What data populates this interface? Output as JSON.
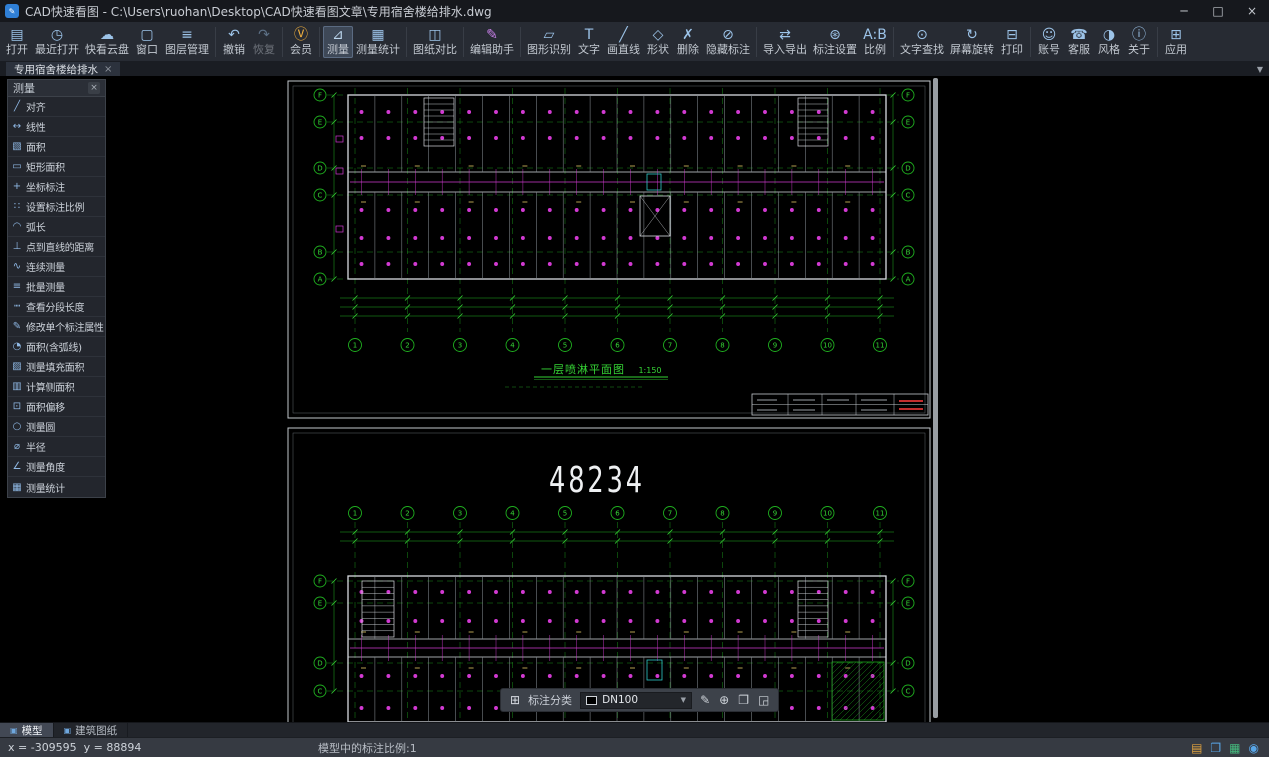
{
  "titlebar": {
    "app_icon_glyph": "✎",
    "title": "CAD快速看图 - C:\\Users\\ruohan\\Desktop\\CAD快速看图文章\\专用宿舍楼给排水.dwg",
    "minimize_glyph": "─",
    "maximize_glyph": "□",
    "close_glyph": "×"
  },
  "ribbon": {
    "buttons": [
      {
        "label": "打开",
        "icon": "▤",
        "name": "open"
      },
      {
        "label": "最近打开",
        "icon": "◷",
        "name": "recent-files"
      },
      {
        "label": "快看云盘",
        "icon": "☁",
        "name": "cloud-drive"
      },
      {
        "label": "窗口",
        "icon": "▢",
        "name": "window"
      },
      {
        "label": "图层管理",
        "icon": "≡",
        "name": "layer-manager"
      },
      {
        "type": "sep"
      },
      {
        "label": "撤销",
        "icon": "↶",
        "name": "undo"
      },
      {
        "label": "恢复",
        "icon": "↷",
        "name": "redo",
        "state": "disabled"
      },
      {
        "type": "sep"
      },
      {
        "label": "会员",
        "icon": "Ⓥ",
        "name": "vip-member",
        "color": "#f2b13e"
      },
      {
        "type": "sep"
      },
      {
        "label": "测量",
        "icon": "⊿",
        "name": "measure",
        "state": "selected",
        "color": "#bcd6ee"
      },
      {
        "label": "测量统计",
        "icon": "▦",
        "name": "measure-statistics"
      },
      {
        "type": "sep"
      },
      {
        "label": "图纸对比",
        "icon": "◫",
        "name": "drawing-compare"
      },
      {
        "type": "sep"
      },
      {
        "label": "编辑助手",
        "icon": "✎",
        "name": "edit-assistant",
        "color": "#c77fe8"
      },
      {
        "type": "sep"
      },
      {
        "label": "图形识别",
        "icon": "▱",
        "name": "shape-recognition"
      },
      {
        "label": "文字",
        "icon": "T",
        "name": "text"
      },
      {
        "label": "画直线",
        "icon": "╱",
        "name": "draw-line"
      },
      {
        "label": "形状",
        "icon": "◇",
        "name": "shapes"
      },
      {
        "label": "删除",
        "icon": "✗",
        "name": "delete"
      },
      {
        "label": "隐藏标注",
        "icon": "⊘",
        "name": "hide-annotations"
      },
      {
        "type": "sep"
      },
      {
        "label": "导入导出",
        "icon": "⇄",
        "name": "import-export"
      },
      {
        "label": "标注设置",
        "icon": "⊛",
        "name": "annotation-settings"
      },
      {
        "label": "比例",
        "icon": "A:B",
        "name": "scale"
      },
      {
        "type": "sep"
      },
      {
        "label": "文字查找",
        "icon": "⊙",
        "name": "text-search"
      },
      {
        "label": "屏幕旋转",
        "icon": "↻",
        "name": "screen-rotate"
      },
      {
        "label": "打印",
        "icon": "⊟",
        "name": "print"
      },
      {
        "type": "sep"
      },
      {
        "label": "账号",
        "icon": "☺",
        "name": "account"
      },
      {
        "label": "客服",
        "icon": "☎",
        "name": "customer-service"
      },
      {
        "label": "风格",
        "icon": "◑",
        "name": "ui-style"
      },
      {
        "label": "关于",
        "icon": "ⓘ",
        "name": "about"
      },
      {
        "type": "sep"
      },
      {
        "label": "应用",
        "icon": "⊞",
        "name": "apps"
      }
    ]
  },
  "doc_tab": {
    "label": "专用宿舍楼给排水",
    "close_glyph": "×",
    "overflow_glyph": "▼"
  },
  "measure_panel": {
    "title": "测量",
    "close_glyph": "×",
    "items": [
      {
        "label": "对齐",
        "icon": "╱",
        "name": "align"
      },
      {
        "label": "线性",
        "icon": "↔",
        "name": "linear"
      },
      {
        "label": "面积",
        "icon": "▧",
        "name": "area"
      },
      {
        "label": "矩形面积",
        "icon": "▭",
        "name": "rect-area"
      },
      {
        "label": "坐标标注",
        "icon": "+",
        "name": "coordinate-annotation"
      },
      {
        "label": "设置标注比例",
        "icon": "∷",
        "name": "set-annotation-scale"
      },
      {
        "label": "弧长",
        "icon": "◠",
        "name": "arc-length"
      },
      {
        "label": "点到直线的距离",
        "icon": "⊥",
        "name": "point-to-line-distance"
      },
      {
        "label": "连续测量",
        "icon": "∿",
        "name": "continuous-measure"
      },
      {
        "label": "批量测量",
        "icon": "≡",
        "name": "batch-measure"
      },
      {
        "label": "查看分段长度",
        "icon": "┉",
        "name": "segment-length"
      },
      {
        "label": "修改单个标注属性",
        "icon": "✎",
        "name": "modify-annotation-property"
      },
      {
        "label": "面积(含弧线)",
        "icon": "◔",
        "name": "area-with-arc"
      },
      {
        "label": "测量填充面积",
        "icon": "▨",
        "name": "measure-fill-area"
      },
      {
        "label": "计算侧面积",
        "icon": "▥",
        "name": "calc-side-area"
      },
      {
        "label": "面积偏移",
        "icon": "⊡",
        "name": "area-offset"
      },
      {
        "label": "测量圆",
        "icon": "○",
        "name": "measure-circle"
      },
      {
        "label": "半径",
        "icon": "⌀",
        "name": "radius"
      },
      {
        "label": "测量角度",
        "icon": "∠",
        "name": "measure-angle"
      },
      {
        "label": "测量统计",
        "icon": "▦",
        "name": "measure-statistics"
      }
    ]
  },
  "annotation_toolbar": {
    "grid_glyph": "⊞",
    "label": "标注分类",
    "value": "DN100",
    "caret_glyph": "▼",
    "tools": [
      {
        "icon": "✎",
        "name": "edit"
      },
      {
        "icon": "⊕",
        "name": "move"
      },
      {
        "icon": "❐",
        "name": "copy"
      },
      {
        "icon": "◲",
        "name": "paste"
      }
    ]
  },
  "bottom_tabs": [
    {
      "label": "模型",
      "icon": "▣",
      "name": "model-tab",
      "state": "active"
    },
    {
      "label": "建筑图纸",
      "icon": "▣",
      "name": "construction-drawings-tab"
    }
  ],
  "statusbar": {
    "coords": "x = -309595  y = 88894",
    "scale_text": "模型中的标注比例:1",
    "icons": [
      {
        "icon": "▤",
        "color": "#e0a23f",
        "name": "statusbar-1"
      },
      {
        "icon": "❐",
        "color": "#58a6e8",
        "name": "statusbar-2"
      },
      {
        "icon": "▦",
        "color": "#45b97d",
        "name": "statusbar-3"
      },
      {
        "icon": "◉",
        "color": "#58a6e8",
        "name": "statusbar-4"
      }
    ]
  },
  "drawing": {
    "sheet1": {
      "axis_numbers": [
        "1",
        "2",
        "3",
        "4",
        "5",
        "6",
        "7",
        "8",
        "9",
        "10",
        "11"
      ],
      "axis_letters": [
        "F",
        "E",
        "D",
        "C",
        "B",
        "A"
      ],
      "title": "一层喷淋平面图",
      "scale": "1:150"
    },
    "sheet2": {
      "big_label": "48234",
      "axis_numbers": [
        "1",
        "2",
        "3",
        "4",
        "5",
        "6",
        "7",
        "8",
        "9",
        "10",
        "11"
      ],
      "axis_letters": [
        "F",
        "E",
        "D",
        "C"
      ]
    },
    "colors": {
      "grid_green": "#1faf1f",
      "text_green": "#35d435",
      "pipe_magenta": "#d23ad2",
      "wall": "#d7dbe0",
      "cyan": "#2ec8c8",
      "sheet_border": "#c2c7cd",
      "red": "#e03535",
      "big_label_color": "#eef0f2"
    }
  }
}
